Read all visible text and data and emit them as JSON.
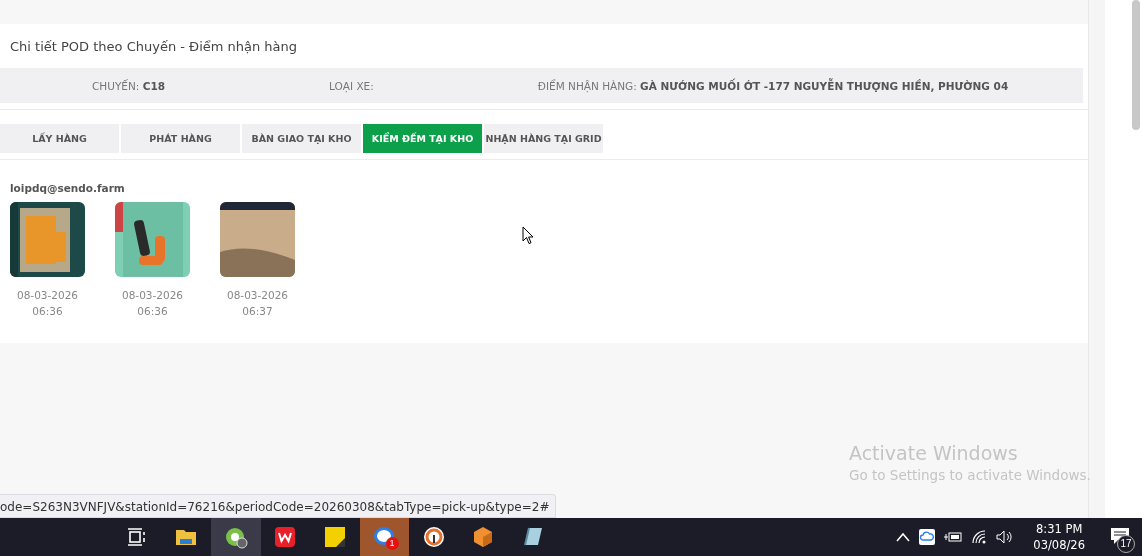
{
  "card": {
    "title": "Chi tiết POD theo Chuyến - Điểm nhận hàng",
    "info": [
      {
        "label": "CHUYẾN:",
        "value": "C18"
      },
      {
        "label": "LOẠI XE:"
      },
      {
        "label": "ĐIỂM NHẬN HÀNG:",
        "value": "GÀ NƯỚNG MUỐI ỚT -177 NGUYỄN THƯỢNG HIỀN, PHƯỜNG 04"
      }
    ],
    "tabs": [
      {
        "label": "LẤY HÀNG",
        "selected": false
      },
      {
        "label": "PHÁT HÀNG",
        "selected": false
      },
      {
        "label": "BÀN GIAO TẠI KHO",
        "selected": false
      },
      {
        "label": "KIỂM ĐẾM TẠI KHO",
        "selected": true
      },
      {
        "label": "NHẬN HÀNG TẠI GRID",
        "selected": false
      }
    ],
    "user": "loipdq@sendo.farm",
    "photos": [
      {
        "kind": "picture",
        "date": "08-03-2026",
        "time": "06:36"
      },
      {
        "kind": "picture",
        "date": "08-03-2026",
        "time": "06:36"
      },
      {
        "kind": "picture",
        "date": "08-03-2026",
        "time": "06:37"
      }
    ]
  },
  "activation": {
    "title": "Activate Windows",
    "subtitle": "Go to Settings to activate Windows."
  },
  "status_url": "ode=S263N3VNFJV&stationId=76216&periodCode=20260308&tabType=pick-up&type=2#",
  "taskbar": {
    "apps": [
      {
        "selected": false
      },
      {
        "selected": false
      },
      {
        "selected": true
      },
      {
        "selected": false
      },
      {
        "selected": false
      },
      {
        "selected": false,
        "badge": "1"
      },
      {
        "selected": false
      },
      {
        "selected": false
      },
      {
        "selected": false
      }
    ],
    "time": "8:31 PM",
    "date": "03/08/26",
    "notifications": "17"
  }
}
